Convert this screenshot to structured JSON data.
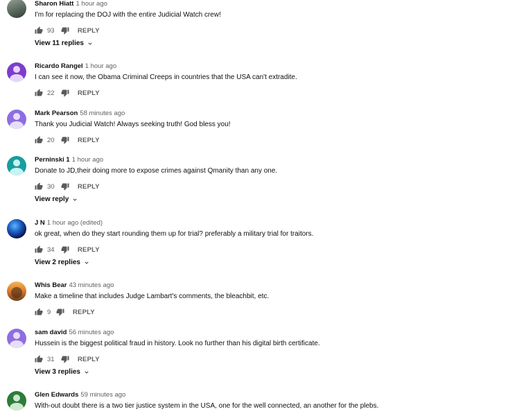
{
  "comments": [
    {
      "author": "Sharon Hiatt",
      "time": "1 hour ago",
      "text": "I'm for replacing the DOJ with the entire Judicial Watch crew!",
      "likes": "93",
      "reply_label": "REPLY",
      "replies_label": "View 11 replies",
      "avatar": "photo-dark"
    },
    {
      "author": "Ricardo Rangel",
      "time": "1 hour ago",
      "text": "I can see it now, the Obama Criminal Creeps in countries that the USA can't extradite.",
      "likes": "22",
      "reply_label": "REPLY",
      "avatar": "violet"
    },
    {
      "author": "Mark Pearson",
      "time": "58 minutes ago",
      "text": "Thank you Judicial Watch! Always seeking truth! God bless you!",
      "likes": "20",
      "reply_label": "REPLY",
      "avatar": "purple"
    },
    {
      "author": "Perninski 1",
      "time": "1 hour ago",
      "text": "Donate to JD,their doing more to expose crimes against Qmanity than any one.",
      "likes": "30",
      "reply_label": "REPLY",
      "replies_label": "View reply",
      "avatar": "teal"
    },
    {
      "author": "J N",
      "time": "1 hour ago (edited)",
      "text": "ok great, when do they start rounding them up for  trial? preferably a military trial for traitors.",
      "likes": "34",
      "reply_label": "REPLY",
      "replies_label": "View 2 replies",
      "avatar": "photo-sea"
    },
    {
      "author": "Whis Bear",
      "time": "43 minutes ago",
      "text": "Make a timeline that includes Judge Lambart's comments, the bleachbit, etc.",
      "likes": "9",
      "reply_label": "REPLY",
      "avatar": "photo-sun"
    },
    {
      "author": "sam david",
      "time": "56 minutes ago",
      "text": "Hussein is the biggest political fraud in history. Look no further than his digital birth certificate.",
      "likes": "31",
      "reply_label": "REPLY",
      "replies_label": "View 3 replies",
      "avatar": "purple"
    },
    {
      "author": "Glen Edwards",
      "time": "59 minutes ago",
      "text": "With-out doubt there is a two tier justice system in the USA, one for the well connected, an another for the plebs.",
      "avatar": "green"
    }
  ]
}
